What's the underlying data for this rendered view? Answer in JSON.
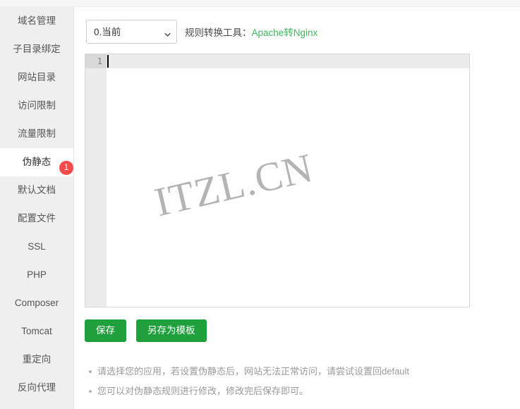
{
  "sidebar": {
    "items": [
      {
        "label": "域名管理",
        "active": false,
        "badge": null
      },
      {
        "label": "子目录绑定",
        "active": false,
        "badge": null
      },
      {
        "label": "网站目录",
        "active": false,
        "badge": null
      },
      {
        "label": "访问限制",
        "active": false,
        "badge": null
      },
      {
        "label": "流量限制",
        "active": false,
        "badge": null
      },
      {
        "label": "伪静态",
        "active": true,
        "badge": "1"
      },
      {
        "label": "默认文档",
        "active": false,
        "badge": null
      },
      {
        "label": "配置文件",
        "active": false,
        "badge": null
      },
      {
        "label": "SSL",
        "active": false,
        "badge": null
      },
      {
        "label": "PHP",
        "active": false,
        "badge": null
      },
      {
        "label": "Composer",
        "active": false,
        "badge": null
      },
      {
        "label": "Tomcat",
        "active": false,
        "badge": null
      },
      {
        "label": "重定向",
        "active": false,
        "badge": null
      },
      {
        "label": "反向代理",
        "active": false,
        "badge": null
      }
    ]
  },
  "toolbar": {
    "select_value": "0.当前",
    "select_options": [
      "0.当前"
    ],
    "converter_label": "规则转换工具：",
    "converter_link": "Apache转Nginx",
    "link_color": "#3cbb5c"
  },
  "editor": {
    "line_numbers": [
      "1"
    ],
    "content": "",
    "watermark": "ITZL.CN"
  },
  "buttons": {
    "save": "保存",
    "save_as_template": "另存为模板",
    "color": "#20a03c"
  },
  "notes": [
    "请选择您的应用，若设置伪静态后，网站无法正常访问，请尝试设置回default",
    "您可以对伪静态规则进行修改，修改完后保存即可。"
  ]
}
